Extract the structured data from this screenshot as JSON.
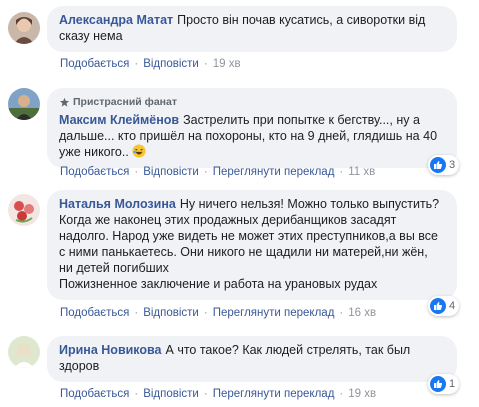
{
  "comments": [
    {
      "author": "Александра Матат",
      "text": "Просто він почав кусатись, а сиворотки від сказу нема",
      "like": "Подобається",
      "reply": "Відповісти",
      "time": "19 хв"
    },
    {
      "badge": "Пристрасний фанат",
      "author": "Максим Клеймёнов",
      "text": "Застрелить при попытке к бегству..., ну а дальше... кто пришёл на похороны, кто на 9 дней, глядишь на 40 уже никого..",
      "like": "Подобається",
      "reply": "Відповісти",
      "translate": "Переглянути переклад",
      "time": "11 хв",
      "reactions": "3"
    },
    {
      "author": "Наталья Молозина",
      "text": "Ну ничего нельзя! Можно только выпустить? Когда же наконец этих продажных дерибанщиков засадят надолго. Народ уже видеть не может этих преступников,а вы все с ними панькаетесь. Они никого не щадили ни матерей,ни жён, ни детей погибших\nПожизненное заключение и работа на урановых рудах",
      "like": "Подобається",
      "reply": "Відповісти",
      "translate": "Переглянути переклад",
      "time": "16 хв",
      "reactions": "4"
    },
    {
      "author": "Ирина Новикова",
      "text": "А что такое? Как людей стрелять, так был здоров",
      "like": "Подобається",
      "reply": "Відповісти",
      "translate": "Переглянути переклад",
      "time": "19 хв",
      "reactions": "1"
    }
  ],
  "colors": {
    "author": "#385898",
    "bubble": "#f0f2f5",
    "like": "#1877f2"
  },
  "icons": [
    "like-icon",
    "haha-emoji-icon",
    "fan-badge-icon"
  ]
}
